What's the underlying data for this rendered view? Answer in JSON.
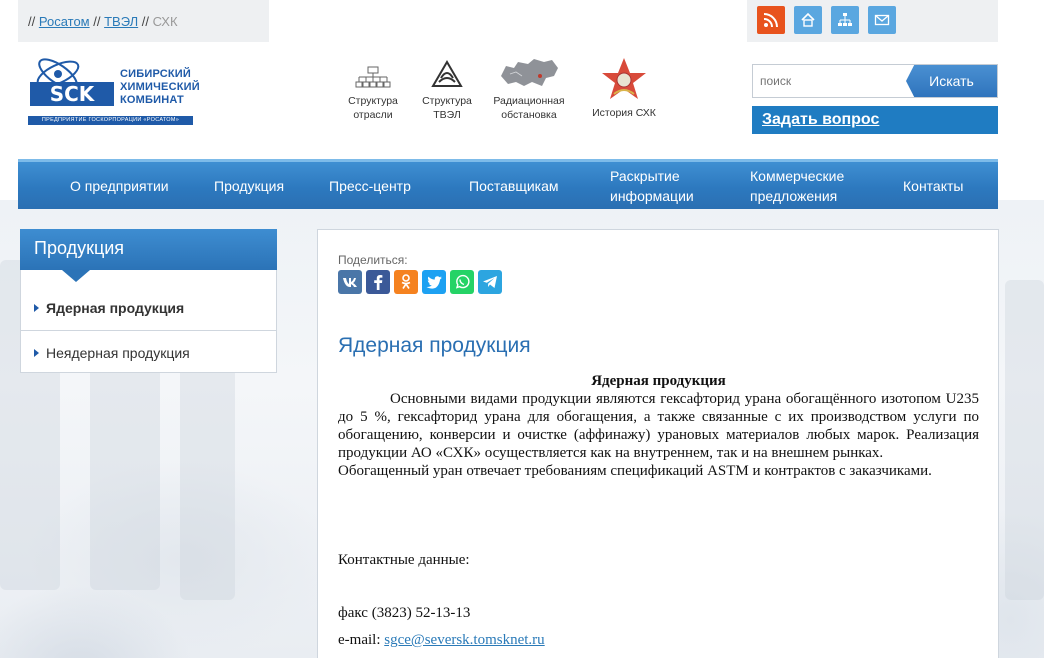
{
  "breadcrumb": {
    "items": [
      "Росатом",
      "ТВЭЛ"
    ],
    "current": "СХК",
    "separator": "//"
  },
  "header_icons": {
    "rss": "rss-icon",
    "home": "home-icon",
    "sitemap": "sitemap-icon",
    "mail": "mail-icon"
  },
  "logo": {
    "mark_text": "SCK",
    "line1": "СИБИРСКИЙ",
    "line2": "ХИМИЧЕСКИЙ",
    "line3": "КОМБИНАТ",
    "strip": "ПРЕДПРИЯТИЕ ГОСКОРПОРАЦИИ «РОСАТОМ»"
  },
  "quick_links": [
    {
      "line1": "Структура",
      "line2": "отрасли",
      "icon": "structure-icon"
    },
    {
      "line1": "Структура",
      "line2": "ТВЭЛ",
      "icon": "tvel-logo-icon"
    },
    {
      "line1": "Радиационная",
      "line2": "обстановка",
      "icon": "russia-map-icon"
    },
    {
      "line1": "История СХК",
      "line2": "",
      "icon": "star-emblem-icon"
    }
  ],
  "search": {
    "placeholder": "поиск",
    "button": "Искать"
  },
  "ask_link": "Задать вопрос",
  "nav": [
    {
      "line1": "О предприятии",
      "line2": ""
    },
    {
      "line1": "Продукция",
      "line2": ""
    },
    {
      "line1": "Пресс-центр",
      "line2": ""
    },
    {
      "line1": "Поставщикам",
      "line2": ""
    },
    {
      "line1": "Раскрытие",
      "line2": "информации"
    },
    {
      "line1": "Коммерческие",
      "line2": "предложения"
    },
    {
      "line1": "Контакты",
      "line2": ""
    }
  ],
  "sidebar": {
    "title": "Продукция",
    "items": [
      {
        "label": "Ядерная продукция",
        "active": true
      },
      {
        "label": "Неядерная продукция",
        "active": false
      }
    ]
  },
  "share": {
    "label": "Поделиться:",
    "buttons": [
      {
        "name": "vk",
        "text": "VK",
        "color": "#4a76a8"
      },
      {
        "name": "facebook",
        "text": "f",
        "color": "#3b5998"
      },
      {
        "name": "odnoklassniki",
        "text": "ок",
        "color": "#f58220"
      },
      {
        "name": "twitter",
        "text": "t",
        "color": "#1da1f2"
      },
      {
        "name": "whatsapp",
        "text": "w",
        "color": "#25d366"
      },
      {
        "name": "telegram",
        "text": "➤",
        "color": "#2ca5e0"
      }
    ]
  },
  "article": {
    "heading": "Ядерная продукция",
    "title": "Ядерная продукция",
    "paragraph1": "Основными видами продукции являются гексафторид урана обогащённого изотопом U235 до 5 %, гексафторид урана для обогащения, а также связанные с их производством услуги по обогащению, конверсии и очистке (аффинажу) урановых материалов любых марок. Реализация продукции АО «СХК» осуществляется как на внутреннем, так и на внешнем рынках.",
    "paragraph2": "Обогащенный уран отвечает требованиям спецификаций ASTM и контрактов с заказчиками.",
    "contacts_label": "Контактные данные:",
    "fax": "факс (3823) 52-13-13",
    "email_label": "e-mail:",
    "email": "sgce@seversk.tomsknet.ru"
  }
}
